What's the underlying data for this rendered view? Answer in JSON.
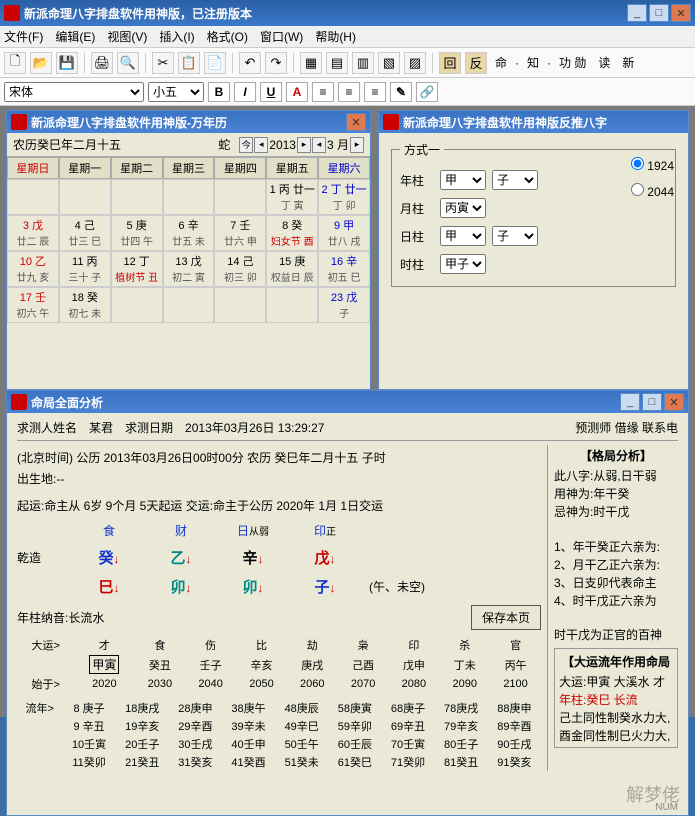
{
  "app": {
    "title": "新派命理八字排盘软件用神版，已注册版本"
  },
  "menus": [
    "文件(F)",
    "编辑(E)",
    "视图(V)",
    "插入(I)",
    "格式(O)",
    "窗口(W)",
    "帮助(H)"
  ],
  "tb_text": [
    "回",
    "反",
    "命",
    "知",
    "功 勋",
    "读",
    "新"
  ],
  "fontbar": {
    "font": "宋体",
    "size": "小五"
  },
  "cal": {
    "title": "新派命理八字排盘软件用神版-万年历",
    "lunar": "农历癸巳年二月十五",
    "zodiac": "蛇",
    "year": "2013",
    "month": "3 月",
    "day_hdr": [
      "星期日",
      "星期一",
      "星期二",
      "星期三",
      "星期四",
      "星期五",
      "星期六"
    ],
    "cells": [
      [
        "",
        "",
        ""
      ],
      [
        "",
        "",
        ""
      ],
      [
        "",
        "",
        ""
      ],
      [
        "",
        "",
        ""
      ],
      [
        "",
        "",
        ""
      ],
      [
        "1 丙 廿一",
        "",
        "丁 寅"
      ],
      [
        "2 丁 廿一",
        "",
        "丁 卯"
      ],
      [
        "3 戊",
        "廿二",
        "辰"
      ],
      [
        "4 己",
        "廿三",
        "巳"
      ],
      [
        "5 庚",
        "廿四",
        "午"
      ],
      [
        "6 辛",
        "廿五",
        "未"
      ],
      [
        "7 壬",
        "廿六",
        "申"
      ],
      [
        "8 癸",
        "妇女节",
        "酉"
      ],
      [
        "9 甲",
        "廿八",
        "戌"
      ],
      [
        "10 乙",
        "廿九",
        "亥"
      ],
      [
        "11 丙",
        "三十",
        "子"
      ],
      [
        "12 丁",
        "植树节",
        "丑"
      ],
      [
        "13 戊",
        "初二",
        "寅"
      ],
      [
        "14 己",
        "初三",
        "卯"
      ],
      [
        "15 庚",
        "权益日",
        "辰"
      ],
      [
        "16 辛",
        "初五",
        "巳"
      ],
      [
        "17 壬",
        "初六",
        "午"
      ],
      [
        "18 癸",
        "初七",
        "未"
      ],
      [
        "",
        "",
        ""
      ],
      [
        "",
        "",
        ""
      ],
      [
        "",
        "",
        ""
      ],
      [
        "",
        "",
        ""
      ],
      [
        "23 戊",
        "",
        "子"
      ]
    ]
  },
  "rpane": {
    "title": "新派命理八字排盘软件用神版反推八字",
    "fs": "方式一",
    "rows": [
      {
        "lbl": "年柱",
        "a": "甲",
        "b": "子"
      },
      {
        "lbl": "月柱",
        "a": "丙寅",
        "b": ""
      },
      {
        "lbl": "日柱",
        "a": "甲",
        "b": "子"
      },
      {
        "lbl": "时柱",
        "a": "甲子",
        "b": ""
      }
    ],
    "radios": [
      "1924",
      "2044"
    ]
  },
  "ana": {
    "title": "命局全面分析",
    "req_name_lbl": "求测人姓名",
    "req_name": "某君",
    "req_date_lbl": "求测日期",
    "req_date": "2013年03月26日 13:29:27",
    "yuce_lbl": "预测师",
    "yuce": "借缘",
    "contact": "联系电",
    "l1": "(北京时间)   公历  2013年03月26日00时00分   农历  癸巳年二月十五   子时",
    "l2": "出生地:--",
    "l3": "起运:命主从 6岁 9个月 5天起运    交运:命主于公历  2020年 1月 1日交运",
    "gods": [
      "食",
      "财",
      "日",
      "印"
    ],
    "gods_suffix": [
      "",
      "",
      "从弱",
      "正"
    ],
    "zao": "乾造",
    "gan": [
      "癸",
      "乙",
      "辛",
      "戊"
    ],
    "gan_cls": [
      "blue",
      "teal",
      "",
      "red"
    ],
    "zhi": [
      "巳",
      "卯",
      "卯",
      "子"
    ],
    "zhi_cls": [
      "red",
      "teal",
      "teal",
      "blue"
    ],
    "kong": "(午、未空)",
    "nayin_lbl": "年柱纳音:",
    "nayin": "长流水",
    "save": "保存本页",
    "right": {
      "hdr": "【格局分析】",
      "l1": "此八字:从弱,日干弱",
      "l2": "用神为:年干癸",
      "l3": "忌神为:时干戊",
      "n1": "1、年干癸正六亲为:",
      "n2": "2、月干乙正六亲为:",
      "n3": "3、日支卯代表命主",
      "n4": "4、时干戊正六亲为",
      "l4": "时干戊为正官的百神"
    },
    "dayun": {
      "lbl": "大运>",
      "heads": [
        "才",
        "食",
        "伤",
        "比",
        "劫",
        "枭",
        "印",
        "杀",
        "官"
      ],
      "gz": [
        "甲寅",
        "癸丑",
        "壬子",
        "辛亥",
        "庚戌",
        "己酉",
        "戊申",
        "丁未",
        "丙午"
      ],
      "start_lbl": "始于>",
      "years": [
        "2020",
        "2030",
        "2040",
        "2050",
        "2060",
        "2070",
        "2080",
        "2090",
        "2100"
      ]
    },
    "liunian": {
      "lbl": "流年>",
      "rows": [
        [
          "8 庚子",
          "18庚戌",
          "28庚申",
          "38庚午",
          "48庚辰",
          "58庚寅",
          "68庚子",
          "78庚戌",
          "88庚申"
        ],
        [
          "9 辛丑",
          "19辛亥",
          "29辛酉",
          "39辛未",
          "49辛巳",
          "59辛卯",
          "69辛丑",
          "79辛亥",
          "89辛酉"
        ],
        [
          "10壬寅",
          "20壬子",
          "30壬戌",
          "40壬申",
          "50壬午",
          "60壬辰",
          "70壬寅",
          "80壬子",
          "90壬戌"
        ],
        [
          "11癸卯",
          "21癸丑",
          "31癸亥",
          "41癸酉",
          "51癸未",
          "61癸巳",
          "71癸卯",
          "81癸丑",
          "91癸亥"
        ]
      ]
    },
    "rbottom": {
      "hdr": "【大运流年作用命局",
      "l1": "大运:甲寅 大溪水 才",
      "l2": "年柱:癸巳 长流",
      "l3": "己土同性制癸水力大,",
      "l4": "酉金同性制巳火力大,"
    }
  },
  "watermark": "解梦佬",
  "wm_num": "NUM"
}
